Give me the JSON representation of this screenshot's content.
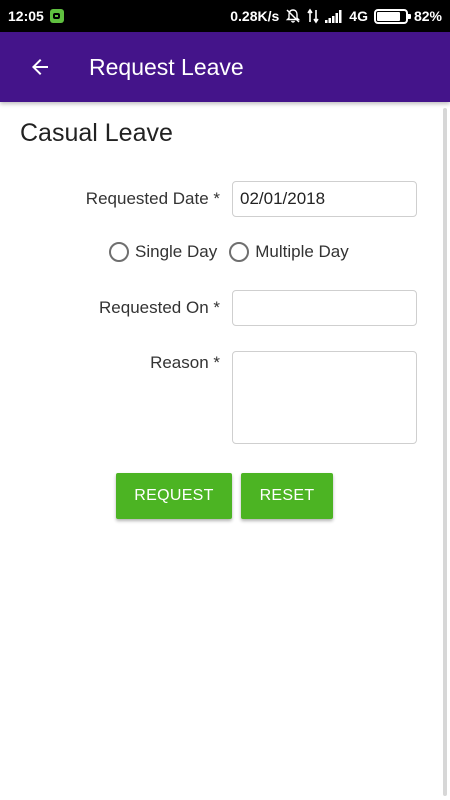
{
  "status_bar": {
    "time": "12:05",
    "network_speed": "0.28K/s",
    "network_type": "4G",
    "battery_percent": "82%",
    "battery_level": 0.82,
    "icons": [
      "notification-app-icon",
      "mute-icon",
      "data-transfer-icon",
      "signal-icon",
      "battery-icon"
    ]
  },
  "app_bar": {
    "title": "Request Leave",
    "background": "#44148a",
    "back_icon": "arrow-left-icon"
  },
  "form": {
    "section_title": "Casual Leave",
    "requested_date": {
      "label": "Requested Date *",
      "value": "02/01/2018"
    },
    "day_options": [
      {
        "label": "Single Day",
        "selected": false
      },
      {
        "label": "Multiple Day",
        "selected": false
      }
    ],
    "requested_on": {
      "label": "Requested On *",
      "value": ""
    },
    "reason": {
      "label": "Reason *",
      "value": ""
    },
    "request_button": "REQUEST",
    "reset_button": "RESET",
    "button_color": "#4cb423"
  }
}
